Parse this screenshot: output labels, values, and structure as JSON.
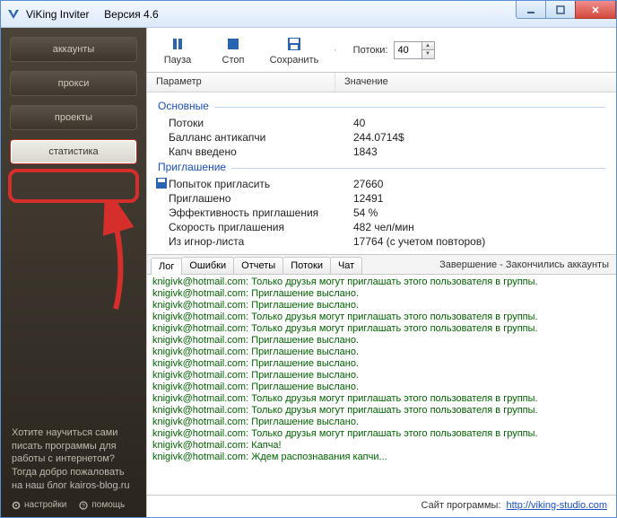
{
  "window": {
    "title": "ViKing Inviter",
    "version_label": "Версия 4.6"
  },
  "sidebar": {
    "items": [
      {
        "label": "аккаунты"
      },
      {
        "label": "прокси"
      },
      {
        "label": "проекты"
      },
      {
        "label": "статистика"
      }
    ],
    "promo": "Хотите научиться сами писать программы для работы с интернетом? Тогда добро пожаловать на наш блог kairos-blog.ru",
    "settings_label": "настройки",
    "help_label": "помощь"
  },
  "toolbar": {
    "pause": "Пауза",
    "stop": "Стоп",
    "save": "Сохранить",
    "threads_label": "Потоки:",
    "threads_value": "40"
  },
  "columns": {
    "param": "Параметр",
    "value": "Значение"
  },
  "stats": {
    "group1": {
      "title": "Основные",
      "rows": [
        {
          "k": "Потоки",
          "v": "40"
        },
        {
          "k": "Балланс антикапчи",
          "v": "244.0714$"
        },
        {
          "k": "Капч введено",
          "v": "1843"
        }
      ]
    },
    "group2": {
      "title": "Приглашение",
      "rows": [
        {
          "k": "Попыток пригласить",
          "v": "27660",
          "icon": true
        },
        {
          "k": "Приглашено",
          "v": "12491"
        },
        {
          "k": "Эффективность приглашения",
          "v": "54 %"
        },
        {
          "k": "Скорость приглашения",
          "v": "482 чел/мин"
        },
        {
          "k": "Из игнор-листа",
          "v": "17764 (с учетом повторов)"
        }
      ]
    }
  },
  "tabs": {
    "items": [
      "Лог",
      "Ошибки",
      "Отчеты",
      "Потоки",
      "Чат"
    ],
    "status": "Завершение - Закончились аккаунты"
  },
  "log": [
    {
      "u": "knigivk@hotmail.com",
      "m": "Только друзья могут приглашать этого пользователя в группы."
    },
    {
      "u": "knigivk@hotmail.com",
      "m": "Приглашение выслано."
    },
    {
      "u": "knigivk@hotmail.com",
      "m": "Приглашение выслано."
    },
    {
      "u": "knigivk@hotmail.com",
      "m": "Только друзья могут приглашать этого пользователя в группы."
    },
    {
      "u": "knigivk@hotmail.com",
      "m": "Только друзья могут приглашать этого пользователя в группы."
    },
    {
      "u": "knigivk@hotmail.com",
      "m": "Приглашение выслано."
    },
    {
      "u": "knigivk@hotmail.com",
      "m": "Приглашение выслано."
    },
    {
      "u": "knigivk@hotmail.com",
      "m": "Приглашение выслано."
    },
    {
      "u": "knigivk@hotmail.com",
      "m": "Приглашение выслано."
    },
    {
      "u": "knigivk@hotmail.com",
      "m": "Приглашение выслано."
    },
    {
      "u": "knigivk@hotmail.com",
      "m": "Только друзья могут приглашать этого пользователя в группы."
    },
    {
      "u": "knigivk@hotmail.com",
      "m": "Только друзья могут приглашать этого пользователя в группы."
    },
    {
      "u": "knigivk@hotmail.com",
      "m": "Приглашение выслано."
    },
    {
      "u": "knigivk@hotmail.com",
      "m": "Только друзья могут приглашать этого пользователя в группы."
    },
    {
      "u": "knigivk@hotmail.com",
      "m": "Капча!"
    },
    {
      "u": "knigivk@hotmail.com",
      "m": "Ждем распознавания капчи..."
    }
  ],
  "statusbar": {
    "label": "Сайт программы:",
    "link": "http://viking-studio.com"
  }
}
